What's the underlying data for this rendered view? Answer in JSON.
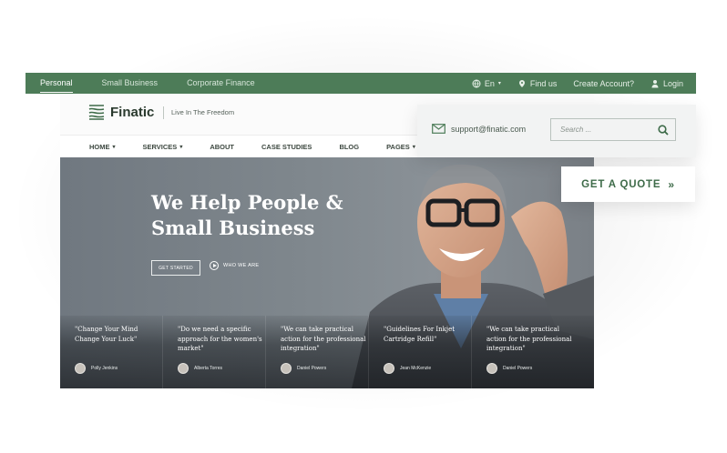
{
  "topbar": {
    "tabs": [
      {
        "label": "Personal",
        "active": true
      },
      {
        "label": "Small Business",
        "active": false
      },
      {
        "label": "Corporate Finance",
        "active": false
      }
    ],
    "language": "En",
    "find_us": "Find us",
    "create_account": "Create Account?",
    "login": "Login"
  },
  "header": {
    "brand": "Finatic",
    "tagline": "Live In The Freedom"
  },
  "nav": {
    "items": [
      {
        "label": "HOME",
        "dropdown": true
      },
      {
        "label": "SERVICES",
        "dropdown": true
      },
      {
        "label": "ABOUT",
        "dropdown": false
      },
      {
        "label": "CASE STUDIES",
        "dropdown": false
      },
      {
        "label": "BLOG",
        "dropdown": false
      },
      {
        "label": "PAGES",
        "dropdown": true
      }
    ]
  },
  "contact": {
    "email": "support@finatic.com",
    "search_placeholder": "Search ..."
  },
  "quote_button": "GET A QUOTE",
  "hero": {
    "title": "We Help People & Small Business",
    "get_started": "GET STARTED",
    "who_we_are": "WHO WE ARE"
  },
  "testimonials": [
    {
      "quote": "\"Change Your Mind Change Your Luck\"",
      "author": "Polly Jenkins"
    },
    {
      "quote": "\"Do we need a specific approach for the women's market\"",
      "author": "Alberta Torres"
    },
    {
      "quote": "\"We can take practical action for the professional integration\"",
      "author": "Daniel Powers"
    },
    {
      "quote": "\"Guidelines For Inkjet Cartridge Refill\"",
      "author": "Jean McKenzie"
    },
    {
      "quote": "\"We can take practical action for the professional integration\"",
      "author": "Daniel Powers"
    }
  ],
  "colors": {
    "brand_green": "#4d7c58",
    "accent_green": "#3e6b49"
  }
}
